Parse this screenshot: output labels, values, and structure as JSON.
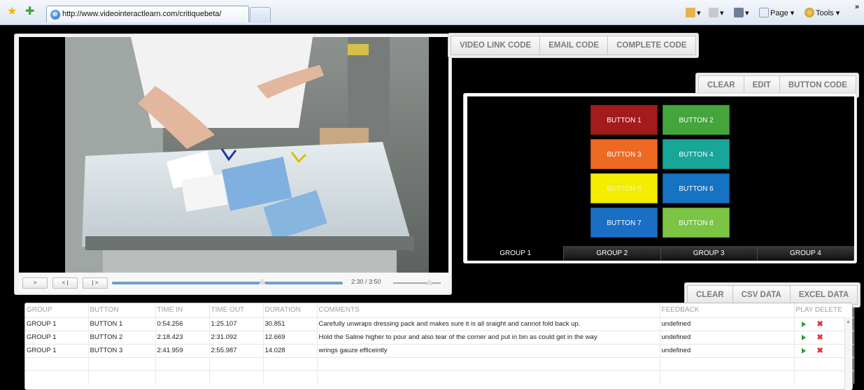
{
  "browser": {
    "tab": {
      "url": "http://www.videointeractlearn.com/critiquebeta/"
    },
    "toolbar": {
      "page_label": "Page",
      "tools_label": "Tools",
      "chevron": "»"
    },
    "icons": [
      "favorites-star-icon",
      "add-favorites-icon",
      "ie-logo-icon",
      "home-icon",
      "feeds-icon",
      "print-icon",
      "page-icon",
      "tools-gear-icon"
    ]
  },
  "video": {
    "controls": {
      "play_label": ">",
      "prev_label": "< |",
      "next_label": "| >",
      "time": "2:30 / 3:50",
      "seek_progress": 0.653,
      "volume_level": 0.76
    }
  },
  "code_buttons": [
    "VIDEO LINK CODE",
    "EMAIL CODE",
    "COMPLETE CODE"
  ],
  "button_toolbar": [
    "CLEAR",
    "EDIT",
    "BUTTON CODE"
  ],
  "critique_buttons": [
    {
      "label": "BUTTON 1",
      "color": "#a31b1b",
      "text_color": "#ffffff"
    },
    {
      "label": "BUTTON 2",
      "color": "#43a53c",
      "text_color": "#ffffff"
    },
    {
      "label": "BUTTON 3",
      "color": "#ee6a22",
      "text_color": "#ffffff"
    },
    {
      "label": "BUTTON 4",
      "color": "#17a698",
      "text_color": "#ffffff"
    },
    {
      "label": "BUTTON 5",
      "color": "#f3ee00",
      "text_color": "#f7f4a0"
    },
    {
      "label": "BUTTON 6",
      "color": "#1573c2",
      "text_color": "#ffffff"
    },
    {
      "label": "BUTTON 7",
      "color": "#1a6fc5",
      "text_color": "#ffffff"
    },
    {
      "label": "BUTTON 8",
      "color": "#7cc443",
      "text_color": "#ffffff"
    }
  ],
  "groups": [
    "GROUP 1",
    "GROUP 2",
    "GROUP 3",
    "GROUP 4"
  ],
  "data_toolbar": [
    "CLEAR",
    "CSV DATA",
    "EXCEL DATA"
  ],
  "table": {
    "headers": [
      "GROUP",
      "BUTTON",
      "TIME IN",
      "TIME OUT",
      "DURATION",
      "COMMENTS",
      "FEEDBACK",
      "PLAY DELETE"
    ],
    "rows": [
      {
        "group": "GROUP 1",
        "button": "BUTTON 1",
        "time_in": "0:54.256",
        "time_out": "1:25.107",
        "duration": "30.851",
        "comment": "Carefully unwraps dressing pack and makes sure it is all sraight and cannot fold back up.",
        "feedback": "undefined"
      },
      {
        "group": "GROUP 1",
        "button": "BUTTON 2",
        "time_in": "2:18.423",
        "time_out": "2:31.092",
        "duration": "12.669",
        "comment": "Hold the Saline higher to pour and also tear of the corner and put in bin as could get in the way",
        "feedback": "undefined"
      },
      {
        "group": "GROUP 1",
        "button": "BUTTON 3",
        "time_in": "2:41.959",
        "time_out": "2:55.987",
        "duration": "14.028",
        "comment": "wrings gauze efficeintly",
        "feedback": "undefined"
      }
    ]
  }
}
